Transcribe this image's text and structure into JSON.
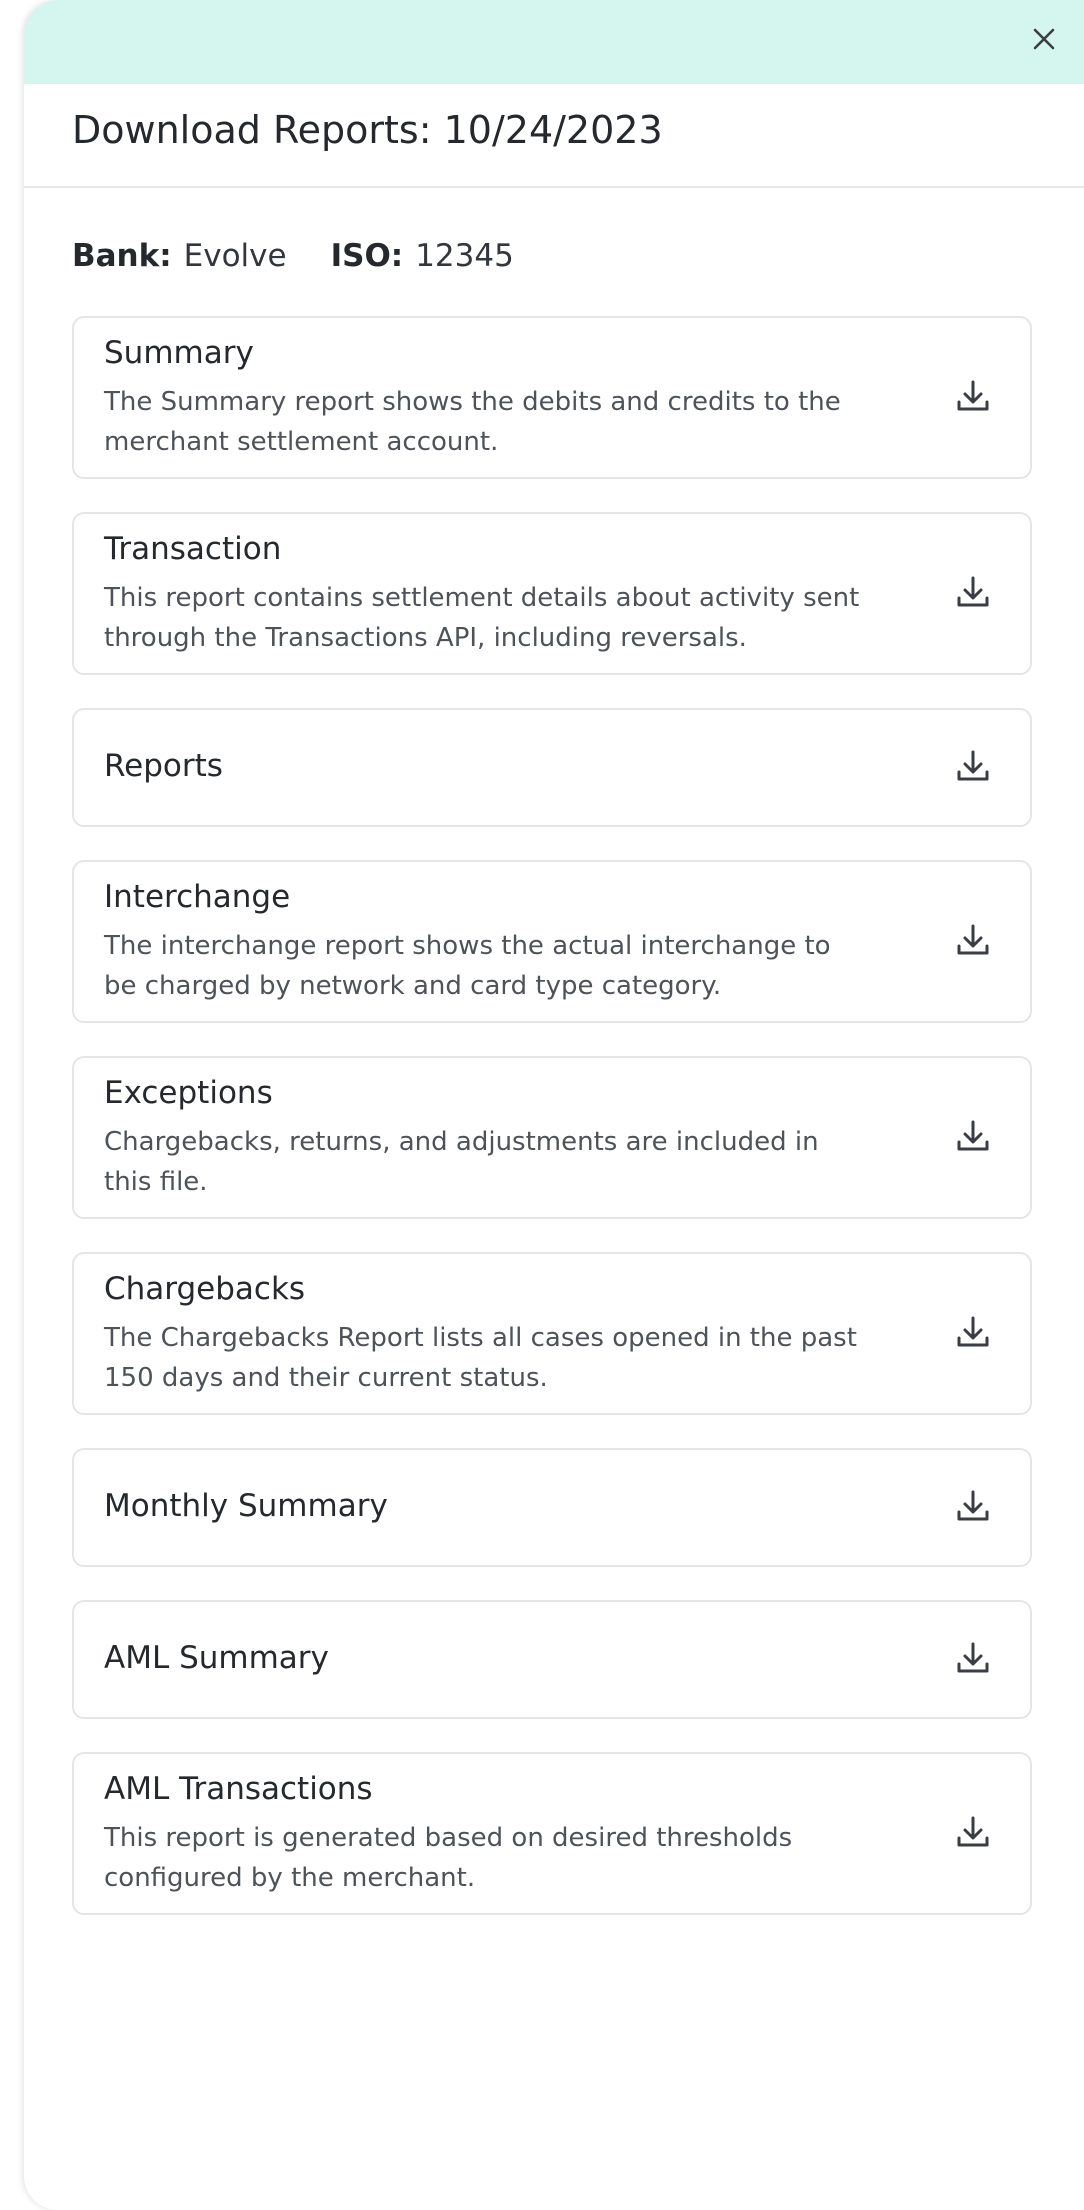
{
  "modal": {
    "title": "Download Reports: 10/24/2023",
    "close_icon": "close-icon",
    "bank_label": "Bank:",
    "bank_value": "Evolve",
    "iso_label": "ISO:",
    "iso_value": "12345"
  },
  "reports": [
    {
      "name": "Summary",
      "description": "The Summary report shows the debits and credits to the merchant settlement account.",
      "icon": "download-icon"
    },
    {
      "name": "Transaction",
      "description": "This report contains settlement details about activity sent through the Transactions API, including reversals.",
      "icon": "download-icon"
    },
    {
      "name": "Reports",
      "description": "",
      "icon": "download-icon"
    },
    {
      "name": "Interchange",
      "description": "The interchange report shows the actual interchange to be charged by network and card type category.",
      "icon": "download-icon"
    },
    {
      "name": "Exceptions",
      "description": "Chargebacks, returns, and adjustments are included in this file.",
      "icon": "download-icon"
    },
    {
      "name": "Chargebacks",
      "description": "The Chargebacks Report lists all cases opened in the past 150 days and their current status.",
      "icon": "download-icon"
    },
    {
      "name": "Monthly Summary",
      "description": "",
      "icon": "download-icon"
    },
    {
      "name": "AML Summary",
      "description": "",
      "icon": "download-icon"
    },
    {
      "name": "AML Transactions",
      "description": "This report is generated based on desired thresholds configured by the merchant.",
      "icon": "download-icon"
    }
  ],
  "colors": {
    "header_bg": "#d5f6ee",
    "text_primary": "#25282d",
    "text_secondary": "#4e535a",
    "card_border": "#e3e5e8"
  }
}
